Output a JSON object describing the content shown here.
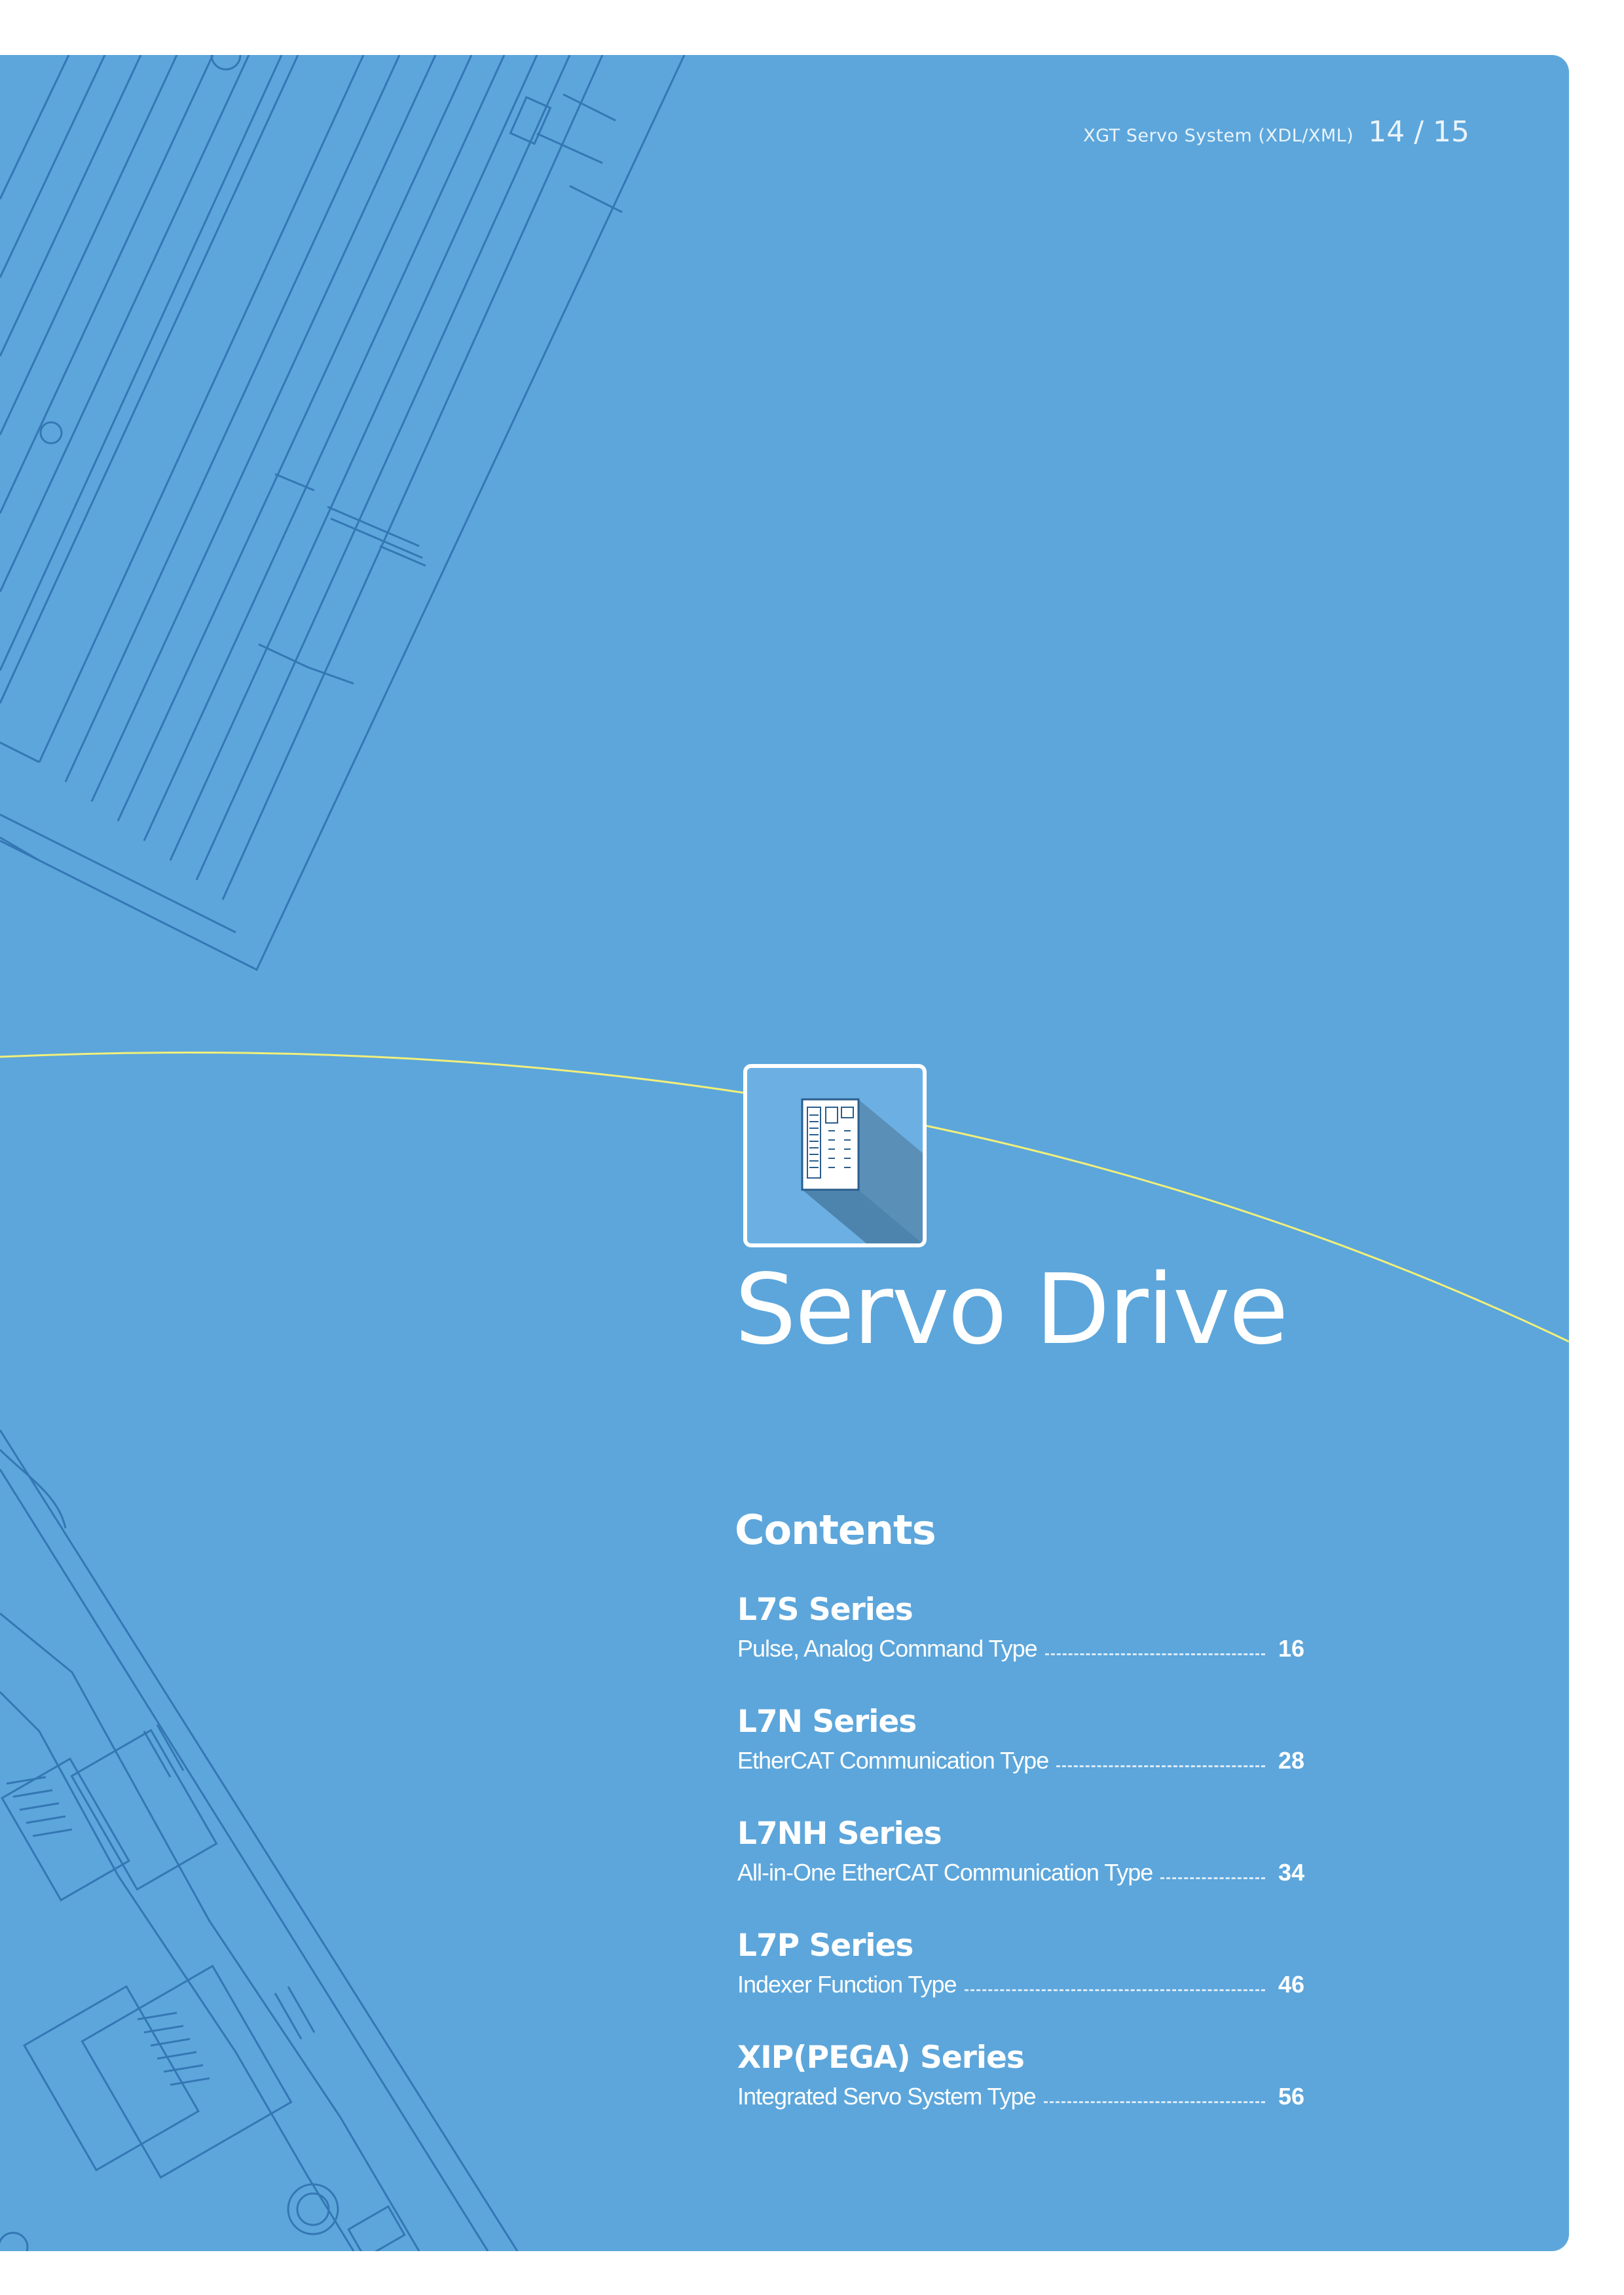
{
  "header": {
    "document_title": "XGT Servo System (XDL/XML)",
    "page_numbers": "14 / 15"
  },
  "section": {
    "title": "Servo Drive",
    "icon": "servo-drive-icon"
  },
  "contents": {
    "heading": "Contents",
    "entries": [
      {
        "series": "L7S Series",
        "description": "Pulse, Analog Command Type",
        "page": "16"
      },
      {
        "series": "L7N Series",
        "description": "EtherCAT Communication Type",
        "page": "28"
      },
      {
        "series": "L7NH Series",
        "description": "All-in-One EtherCAT Communication Type",
        "page": "34"
      },
      {
        "series": "L7P Series",
        "description": "Indexer Function Type",
        "page": "46"
      },
      {
        "series": "XIP(PEGA) Series",
        "description": "Integrated Servo System Type",
        "page": "56"
      }
    ]
  },
  "colors": {
    "background": "#5ca6db",
    "accent_curve": "#f2ef7a",
    "text": "#ffffff"
  }
}
